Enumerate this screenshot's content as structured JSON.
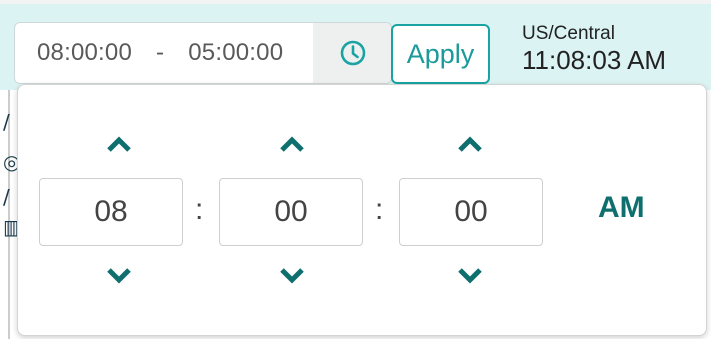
{
  "range": {
    "start": "08:00:00",
    "separator": "-",
    "end": "05:00:00"
  },
  "apply_label": "Apply",
  "timezone": {
    "name": "US/Central",
    "current_time": "11:08:03 AM"
  },
  "picker": {
    "hours": "08",
    "minutes": "00",
    "seconds": "00",
    "colon": ":",
    "meridiem": "AM"
  },
  "background_glyphs": [
    "/",
    "◎",
    "/",
    "▥"
  ],
  "icons": {
    "clock": "clock-icon",
    "up": "chevron-up-icon",
    "down": "chevron-down-icon"
  },
  "colors": {
    "accent": "#1aa3a3",
    "arrow": "#0f6e6e",
    "toolbar_bg": "#dbf3f3"
  }
}
